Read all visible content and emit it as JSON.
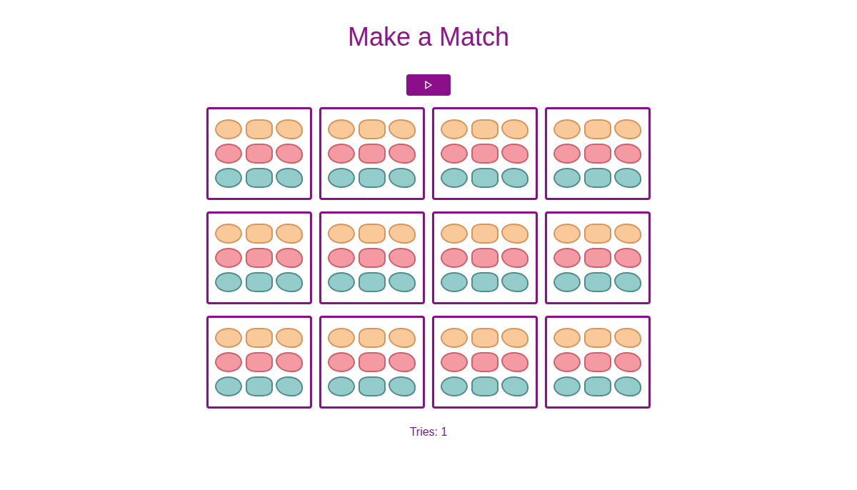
{
  "title": "Make a Match",
  "play_button": {
    "disabled": false
  },
  "cards": [
    {
      "face_up": false
    },
    {
      "face_up": false
    },
    {
      "face_up": false
    },
    {
      "face_up": false
    },
    {
      "face_up": false
    },
    {
      "face_up": false
    },
    {
      "face_up": false
    },
    {
      "face_up": false
    },
    {
      "face_up": false
    },
    {
      "face_up": false
    },
    {
      "face_up": false
    },
    {
      "face_up": false
    }
  ],
  "tries": "Tries: 1"
}
